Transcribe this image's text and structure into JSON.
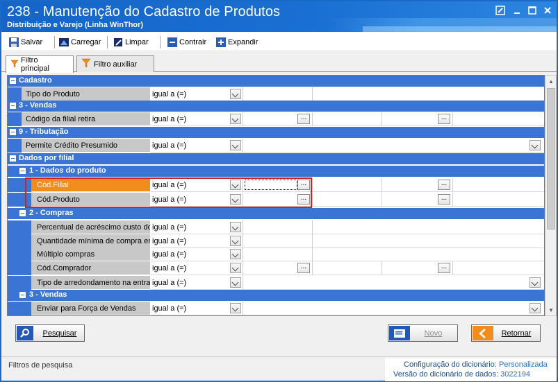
{
  "window": {
    "title": "238 - Manutenção do Cadastro de Produtos",
    "subtitle": "Distribuição e Varejo (Linha WinThor)"
  },
  "toolbar": {
    "save": "Salvar",
    "load": "Carregar",
    "clear": "Limpar",
    "collapse": "Contrair",
    "expand": "Expandir"
  },
  "tabs": {
    "main": "Filtro principal",
    "aux": "Filtro auxiliar"
  },
  "grid": {
    "sections": {
      "cadastro": "Cadastro",
      "vendas3": "3 - Vendas",
      "trib": "9 - Tributação",
      "dados_filial": "Dados por filial",
      "dados_produto": "1 - Dados do produto",
      "compras": "2 - Compras",
      "vendas3b": "3 - Vendas"
    },
    "fields": [
      {
        "label": "Tipo do Produto",
        "op": "igual a (=)"
      },
      {
        "label": "Código da filial retira",
        "op": "igual a (=)"
      },
      {
        "label": "Permite Crédito Presumido",
        "op": "igual a (=)"
      },
      {
        "label": "Cód.Filial",
        "op": "igual a (=)"
      },
      {
        "label": "Cód.Produto",
        "op": "igual a (=)"
      },
      {
        "label": "Percentual de acréscimo custo do",
        "op": "igual a (=)"
      },
      {
        "label": "Quantidade mínima de compra em",
        "op": "igual a (=)"
      },
      {
        "label": "Múltiplo compras",
        "op": "igual a (=)"
      },
      {
        "label": "Cód.Comprador",
        "op": "igual a (=)"
      },
      {
        "label": "Tipo de arredondamento na entra",
        "op": "igual a (=)"
      },
      {
        "label": "Enviar para Força de Vendas",
        "op": "igual a (=)"
      }
    ],
    "ellipsis": "..."
  },
  "buttons": {
    "search": "Pesquisar",
    "new": "Novo",
    "back": "Retornar"
  },
  "status": {
    "left": "Filtros de pesquisa",
    "dict_config_label": "Configuração do dicionário:",
    "dict_config_value": "Personalizada",
    "dict_version_label": "Versão do dicionário de dados:",
    "dict_version_value": "3022194"
  },
  "colors": {
    "title_bar": "#1565c8",
    "section_blue": "#3a75d6",
    "selected_field": "#f28c1d",
    "highlight_box": "#d42020"
  }
}
